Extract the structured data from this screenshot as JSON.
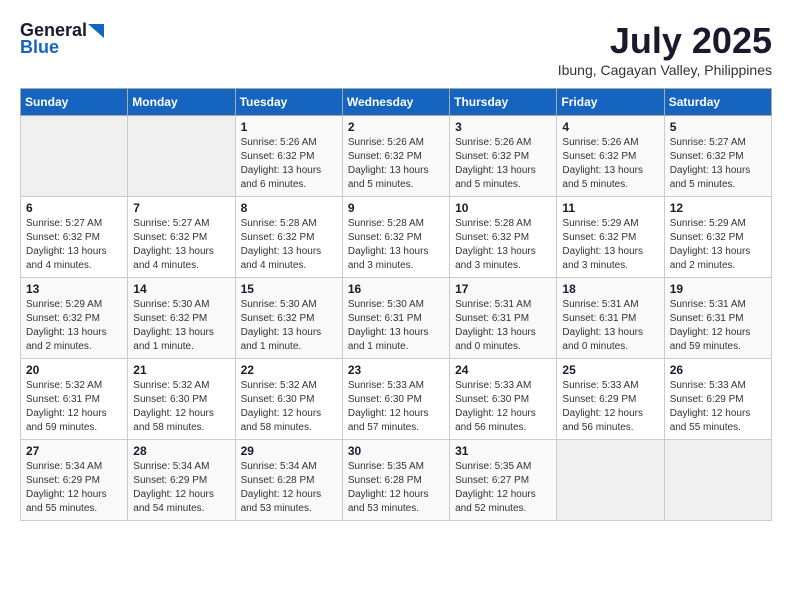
{
  "header": {
    "logo_general": "General",
    "logo_blue": "Blue",
    "month_year": "July 2025",
    "location": "Ibung, Cagayan Valley, Philippines"
  },
  "weekdays": [
    "Sunday",
    "Monday",
    "Tuesday",
    "Wednesday",
    "Thursday",
    "Friday",
    "Saturday"
  ],
  "weeks": [
    [
      {
        "day": "",
        "info": ""
      },
      {
        "day": "",
        "info": ""
      },
      {
        "day": "1",
        "info": "Sunrise: 5:26 AM\nSunset: 6:32 PM\nDaylight: 13 hours\nand 6 minutes."
      },
      {
        "day": "2",
        "info": "Sunrise: 5:26 AM\nSunset: 6:32 PM\nDaylight: 13 hours\nand 5 minutes."
      },
      {
        "day": "3",
        "info": "Sunrise: 5:26 AM\nSunset: 6:32 PM\nDaylight: 13 hours\nand 5 minutes."
      },
      {
        "day": "4",
        "info": "Sunrise: 5:26 AM\nSunset: 6:32 PM\nDaylight: 13 hours\nand 5 minutes."
      },
      {
        "day": "5",
        "info": "Sunrise: 5:27 AM\nSunset: 6:32 PM\nDaylight: 13 hours\nand 5 minutes."
      }
    ],
    [
      {
        "day": "6",
        "info": "Sunrise: 5:27 AM\nSunset: 6:32 PM\nDaylight: 13 hours\nand 4 minutes."
      },
      {
        "day": "7",
        "info": "Sunrise: 5:27 AM\nSunset: 6:32 PM\nDaylight: 13 hours\nand 4 minutes."
      },
      {
        "day": "8",
        "info": "Sunrise: 5:28 AM\nSunset: 6:32 PM\nDaylight: 13 hours\nand 4 minutes."
      },
      {
        "day": "9",
        "info": "Sunrise: 5:28 AM\nSunset: 6:32 PM\nDaylight: 13 hours\nand 3 minutes."
      },
      {
        "day": "10",
        "info": "Sunrise: 5:28 AM\nSunset: 6:32 PM\nDaylight: 13 hours\nand 3 minutes."
      },
      {
        "day": "11",
        "info": "Sunrise: 5:29 AM\nSunset: 6:32 PM\nDaylight: 13 hours\nand 3 minutes."
      },
      {
        "day": "12",
        "info": "Sunrise: 5:29 AM\nSunset: 6:32 PM\nDaylight: 13 hours\nand 2 minutes."
      }
    ],
    [
      {
        "day": "13",
        "info": "Sunrise: 5:29 AM\nSunset: 6:32 PM\nDaylight: 13 hours\nand 2 minutes."
      },
      {
        "day": "14",
        "info": "Sunrise: 5:30 AM\nSunset: 6:32 PM\nDaylight: 13 hours\nand 1 minute."
      },
      {
        "day": "15",
        "info": "Sunrise: 5:30 AM\nSunset: 6:32 PM\nDaylight: 13 hours\nand 1 minute."
      },
      {
        "day": "16",
        "info": "Sunrise: 5:30 AM\nSunset: 6:31 PM\nDaylight: 13 hours\nand 1 minute."
      },
      {
        "day": "17",
        "info": "Sunrise: 5:31 AM\nSunset: 6:31 PM\nDaylight: 13 hours\nand 0 minutes."
      },
      {
        "day": "18",
        "info": "Sunrise: 5:31 AM\nSunset: 6:31 PM\nDaylight: 13 hours\nand 0 minutes."
      },
      {
        "day": "19",
        "info": "Sunrise: 5:31 AM\nSunset: 6:31 PM\nDaylight: 12 hours\nand 59 minutes."
      }
    ],
    [
      {
        "day": "20",
        "info": "Sunrise: 5:32 AM\nSunset: 6:31 PM\nDaylight: 12 hours\nand 59 minutes."
      },
      {
        "day": "21",
        "info": "Sunrise: 5:32 AM\nSunset: 6:30 PM\nDaylight: 12 hours\nand 58 minutes."
      },
      {
        "day": "22",
        "info": "Sunrise: 5:32 AM\nSunset: 6:30 PM\nDaylight: 12 hours\nand 58 minutes."
      },
      {
        "day": "23",
        "info": "Sunrise: 5:33 AM\nSunset: 6:30 PM\nDaylight: 12 hours\nand 57 minutes."
      },
      {
        "day": "24",
        "info": "Sunrise: 5:33 AM\nSunset: 6:30 PM\nDaylight: 12 hours\nand 56 minutes."
      },
      {
        "day": "25",
        "info": "Sunrise: 5:33 AM\nSunset: 6:29 PM\nDaylight: 12 hours\nand 56 minutes."
      },
      {
        "day": "26",
        "info": "Sunrise: 5:33 AM\nSunset: 6:29 PM\nDaylight: 12 hours\nand 55 minutes."
      }
    ],
    [
      {
        "day": "27",
        "info": "Sunrise: 5:34 AM\nSunset: 6:29 PM\nDaylight: 12 hours\nand 55 minutes."
      },
      {
        "day": "28",
        "info": "Sunrise: 5:34 AM\nSunset: 6:29 PM\nDaylight: 12 hours\nand 54 minutes."
      },
      {
        "day": "29",
        "info": "Sunrise: 5:34 AM\nSunset: 6:28 PM\nDaylight: 12 hours\nand 53 minutes."
      },
      {
        "day": "30",
        "info": "Sunrise: 5:35 AM\nSunset: 6:28 PM\nDaylight: 12 hours\nand 53 minutes."
      },
      {
        "day": "31",
        "info": "Sunrise: 5:35 AM\nSunset: 6:27 PM\nDaylight: 12 hours\nand 52 minutes."
      },
      {
        "day": "",
        "info": ""
      },
      {
        "day": "",
        "info": ""
      }
    ]
  ]
}
